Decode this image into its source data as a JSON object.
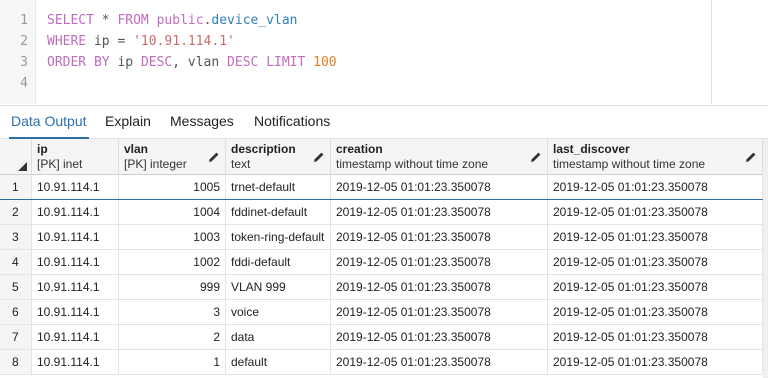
{
  "editor": {
    "lines": [
      {
        "num": "1",
        "tokens": [
          {
            "t": "SELECT",
            "c": "kw"
          },
          {
            "t": " * ",
            "c": "plain"
          },
          {
            "t": "FROM",
            "c": "kw"
          },
          {
            "t": " ",
            "c": "plain"
          },
          {
            "t": "public",
            "c": "kw"
          },
          {
            "t": ".",
            "c": "plain"
          },
          {
            "t": "device_vlan",
            "c": "ident"
          }
        ]
      },
      {
        "num": "2",
        "tokens": [
          {
            "t": "WHERE",
            "c": "kw"
          },
          {
            "t": " ip = ",
            "c": "plain"
          },
          {
            "t": "'10.91.114.1'",
            "c": "str"
          }
        ]
      },
      {
        "num": "3",
        "tokens": [
          {
            "t": "ORDER BY",
            "c": "kw"
          },
          {
            "t": " ip ",
            "c": "plain"
          },
          {
            "t": "DESC",
            "c": "kw"
          },
          {
            "t": ", vlan ",
            "c": "plain"
          },
          {
            "t": "DESC",
            "c": "kw"
          },
          {
            "t": " ",
            "c": "plain"
          },
          {
            "t": "LIMIT",
            "c": "kw"
          },
          {
            "t": " ",
            "c": "plain"
          },
          {
            "t": "100",
            "c": "num"
          }
        ]
      },
      {
        "num": "4",
        "tokens": []
      }
    ]
  },
  "tabs": [
    {
      "label": "Data Output",
      "active": true
    },
    {
      "label": "Explain",
      "active": false
    },
    {
      "label": "Messages",
      "active": false
    },
    {
      "label": "Notifications",
      "active": false
    }
  ],
  "grid": {
    "columns": [
      {
        "name": "ip",
        "type": "[PK] inet"
      },
      {
        "name": "vlan",
        "type": "[PK] integer"
      },
      {
        "name": "description",
        "type": "text"
      },
      {
        "name": "creation",
        "type": "timestamp without time zone"
      },
      {
        "name": "last_discover",
        "type": "timestamp without time zone"
      }
    ],
    "rows": [
      {
        "n": "1",
        "ip": "10.91.114.1",
        "vlan": "1005",
        "description": "trnet-default",
        "creation": "2019-12-05 01:01:23.350078",
        "last_discover": "2019-12-05 01:01:23.350078"
      },
      {
        "n": "2",
        "ip": "10.91.114.1",
        "vlan": "1004",
        "description": "fddinet-default",
        "creation": "2019-12-05 01:01:23.350078",
        "last_discover": "2019-12-05 01:01:23.350078"
      },
      {
        "n": "3",
        "ip": "10.91.114.1",
        "vlan": "1003",
        "description": "token-ring-default",
        "creation": "2019-12-05 01:01:23.350078",
        "last_discover": "2019-12-05 01:01:23.350078"
      },
      {
        "n": "4",
        "ip": "10.91.114.1",
        "vlan": "1002",
        "description": "fddi-default",
        "creation": "2019-12-05 01:01:23.350078",
        "last_discover": "2019-12-05 01:01:23.350078"
      },
      {
        "n": "5",
        "ip": "10.91.114.1",
        "vlan": "999",
        "description": "VLAN 999",
        "creation": "2019-12-05 01:01:23.350078",
        "last_discover": "2019-12-05 01:01:23.350078"
      },
      {
        "n": "6",
        "ip": "10.91.114.1",
        "vlan": "3",
        "description": "voice",
        "creation": "2019-12-05 01:01:23.350078",
        "last_discover": "2019-12-05 01:01:23.350078"
      },
      {
        "n": "7",
        "ip": "10.91.114.1",
        "vlan": "2",
        "description": "data",
        "creation": "2019-12-05 01:01:23.350078",
        "last_discover": "2019-12-05 01:01:23.350078"
      },
      {
        "n": "8",
        "ip": "10.91.114.1",
        "vlan": "1",
        "description": "default",
        "creation": "2019-12-05 01:01:23.350078",
        "last_discover": "2019-12-05 01:01:23.350078"
      }
    ]
  },
  "icons": {
    "column_edit": "pencil-icon",
    "sort_corner": "corner-triangle-icon"
  }
}
